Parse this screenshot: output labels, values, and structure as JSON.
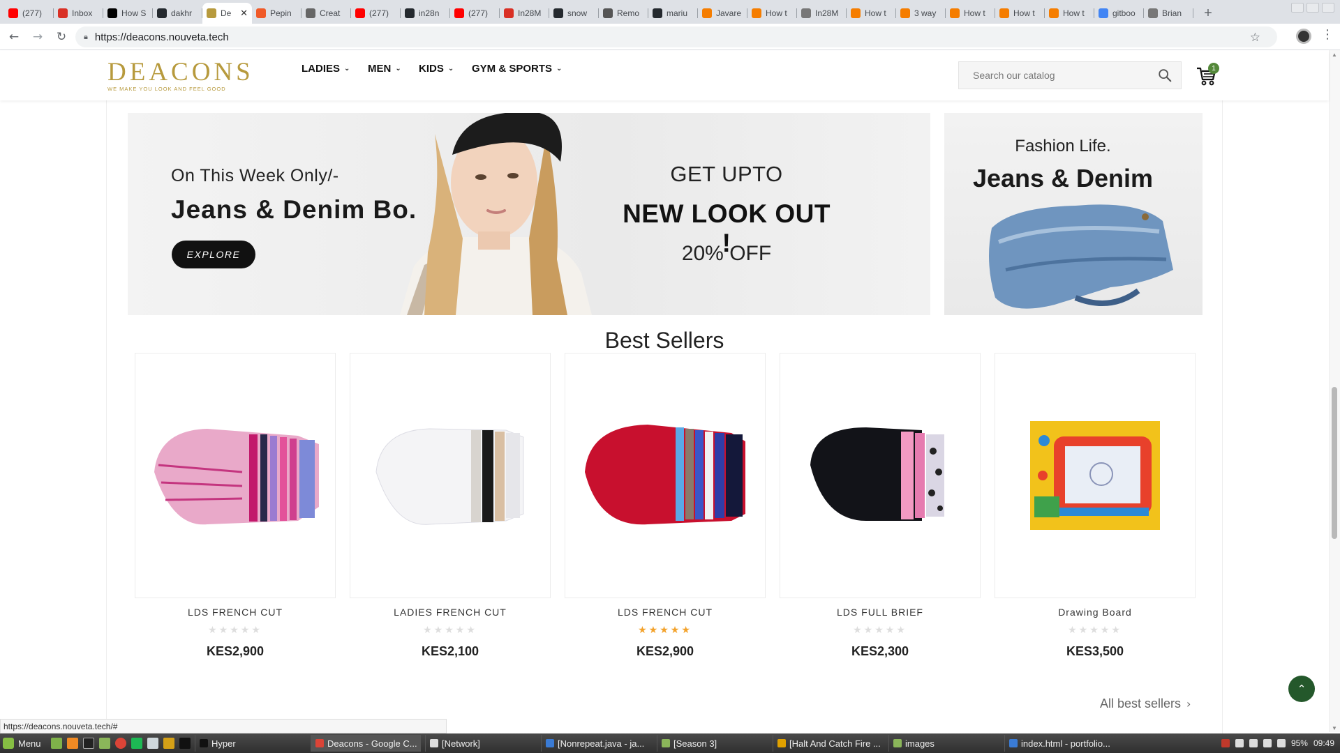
{
  "browser": {
    "tabs": [
      {
        "label": "(277)",
        "fav": "youtube-icon",
        "color": "#ff0000"
      },
      {
        "label": "Inbox",
        "fav": "gmail-icon",
        "color": "#d93025"
      },
      {
        "label": "How S",
        "fav": "medium-icon",
        "color": "#000000"
      },
      {
        "label": "dakhr",
        "fav": "github-icon",
        "color": "#24292e"
      },
      {
        "label": "De",
        "fav": "deacons-icon",
        "color": "#b79a3d",
        "active": true
      },
      {
        "label": "Pepin",
        "fav": "pepin-icon",
        "color": "#f05a28"
      },
      {
        "label": "Creat",
        "fav": "spider-icon",
        "color": "#666666"
      },
      {
        "label": "(277)",
        "fav": "youtube-icon",
        "color": "#ff0000"
      },
      {
        "label": "in28n",
        "fav": "github-icon",
        "color": "#24292e"
      },
      {
        "label": "(277)",
        "fav": "youtube-icon",
        "color": "#ff0000"
      },
      {
        "label": "In28M",
        "fav": "pdf-icon",
        "color": "#d93025"
      },
      {
        "label": "snow",
        "fav": "github-icon",
        "color": "#24292e"
      },
      {
        "label": "Remo",
        "fav": "book-icon",
        "color": "#555555"
      },
      {
        "label": "mariu",
        "fav": "github-icon",
        "color": "#24292e"
      },
      {
        "label": "Javare",
        "fav": "blogger-icon",
        "color": "#f57d00"
      },
      {
        "label": "How t",
        "fav": "blogger-icon",
        "color": "#f57d00"
      },
      {
        "label": "In28M",
        "fav": "doc-icon",
        "color": "#777777"
      },
      {
        "label": "How t",
        "fav": "blogger-icon",
        "color": "#f57d00"
      },
      {
        "label": "3 way",
        "fav": "blogger-icon",
        "color": "#f57d00"
      },
      {
        "label": "How t",
        "fav": "blogger-icon",
        "color": "#f57d00"
      },
      {
        "label": "How t",
        "fav": "blogger-icon",
        "color": "#f57d00"
      },
      {
        "label": "How t",
        "fav": "blogger-icon",
        "color": "#f57d00"
      },
      {
        "label": "gitboo",
        "fav": "google-icon",
        "color": "#4285f4"
      },
      {
        "label": "Brian",
        "fav": "doc-icon",
        "color": "#777777"
      }
    ],
    "new_tab": "+",
    "url": "https://deacons.nouveta.tech",
    "status_url": "https://deacons.nouveta.tech/#"
  },
  "site": {
    "logo": "DEACONS",
    "logo_tagline": "WE MAKE YOU LOOK AND FEEL GOOD",
    "nav": [
      "LADIES",
      "MEN",
      "KIDS",
      "GYM & SPORTS"
    ],
    "search_placeholder": "Search our catalog",
    "cart_count": "1",
    "accent": "#54883a",
    "brand_gold": "#b79a3d"
  },
  "banner_main": {
    "pre": "On This Week Only/-",
    "title": "Jeans & Denim Bo.",
    "button": "EXPLORE",
    "get_upto": "GET UPTO",
    "new_look": "NEW LOOK OUT !",
    "off": "20% OFF"
  },
  "banner_side": {
    "pre": "Fashion Life.",
    "title": "Jeans & Denim"
  },
  "best_sellers": {
    "heading": "Best Sellers",
    "products": [
      {
        "name": "LDS FRENCH CUT",
        "price": "KES2,900",
        "rating": 0,
        "stars": "★★★★★"
      },
      {
        "name": "LADIES FRENCH CUT",
        "price": "KES2,100",
        "rating": 0,
        "stars": "★★★★★"
      },
      {
        "name": "LDS FRENCH CUT",
        "price": "KES2,900",
        "rating": 5,
        "stars": "★★★★★"
      },
      {
        "name": "LDS FULL BRIEF",
        "price": "KES2,300",
        "rating": 0,
        "stars": "★★★★★"
      },
      {
        "name": "Drawing Board",
        "price": "KES3,500",
        "rating": 0,
        "stars": "★★★★★"
      }
    ],
    "all_link": "All best sellers",
    "star_on_color": "#f3a22b",
    "star_off_color": "#dddddd"
  },
  "taskbar": {
    "menu": "Menu",
    "tasks": [
      "Hyper",
      "Deacons - Google C...",
      "[Network]",
      "[Nonrepeat.java - ja...",
      "[Season 3]",
      "[Halt And Catch Fire ...",
      "images",
      "index.html - portfolio..."
    ],
    "battery": "95%",
    "time": "09:49"
  }
}
